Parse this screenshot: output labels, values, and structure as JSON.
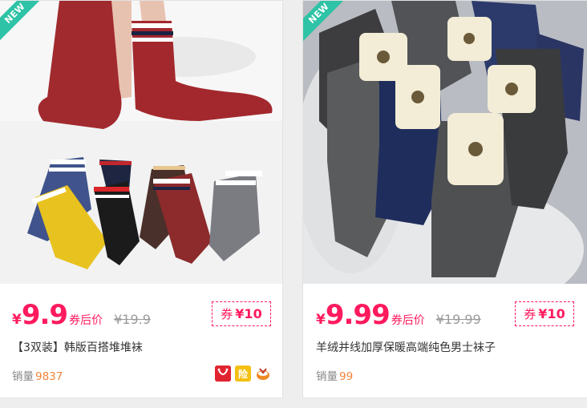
{
  "products": [
    {
      "ribbon": "NEW",
      "currency": "¥",
      "price": "9.9",
      "after_label": "券后价",
      "original_price": "¥19.9",
      "coupon_label": "券",
      "coupon_value": "¥10",
      "title": "【3双装】韩版百搭堆堆袜",
      "sales_label": "销量",
      "sales_count": "9837",
      "badges": [
        "tmall-icon",
        "insurance-icon",
        "gift-icon"
      ],
      "insurance_text": "险"
    },
    {
      "ribbon": "NEW",
      "currency": "¥",
      "price": "9.99",
      "after_label": "券后价",
      "original_price": "¥19.99",
      "coupon_label": "券",
      "coupon_value": "¥10",
      "title": "羊绒并线加厚保暖高端纯色男士袜子",
      "sales_label": "销量",
      "sales_count": "99"
    }
  ],
  "colors": {
    "accent": "#ff1a5e",
    "sales_number": "#f2843a",
    "ribbon": "#2ec3a6"
  }
}
